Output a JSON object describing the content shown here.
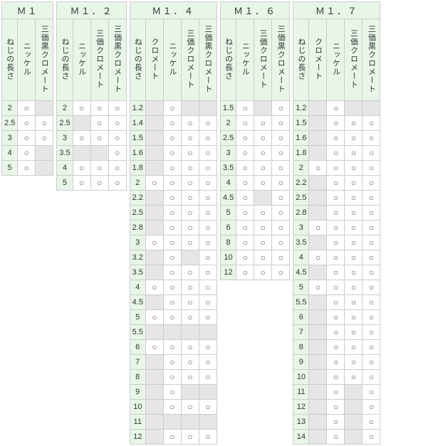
{
  "row_label": "ねじの長さ",
  "columns": {
    "n": "ニッケル",
    "c": "クロメート",
    "s": "三価クロメート",
    "b": "三価黒クロメート"
  },
  "tables": [
    {
      "title": "Ｍ１",
      "cols": [
        "n",
        "b"
      ],
      "rows": [
        {
          "len": "2",
          "v": [
            1,
            null
          ]
        },
        {
          "len": "2.5",
          "v": [
            1,
            1
          ]
        },
        {
          "len": "3",
          "v": [
            1,
            1
          ]
        },
        {
          "len": "4",
          "v": [
            1,
            null
          ]
        },
        {
          "len": "5",
          "v": [
            1,
            null
          ]
        }
      ]
    },
    {
      "title": "Ｍ１．２",
      "cols": [
        "n",
        "s",
        "b"
      ],
      "rows": [
        {
          "len": "2",
          "v": [
            1,
            1,
            1
          ]
        },
        {
          "len": "2.5",
          "v": [
            null,
            1,
            1
          ]
        },
        {
          "len": "3",
          "v": [
            1,
            1,
            1
          ]
        },
        {
          "len": "3.5",
          "v": [
            null,
            null,
            1
          ]
        },
        {
          "len": "4",
          "v": [
            1,
            1,
            1
          ]
        },
        {
          "len": "5",
          "v": [
            1,
            1,
            1
          ]
        }
      ]
    },
    {
      "title": "Ｍ１．４",
      "cols": [
        "c",
        "n",
        "s",
        "b"
      ],
      "rows": [
        {
          "len": "1.2",
          "v": [
            null,
            1,
            null,
            null
          ]
        },
        {
          "len": "1.4",
          "v": [
            null,
            1,
            1,
            1
          ]
        },
        {
          "len": "1.5",
          "v": [
            null,
            1,
            1,
            1
          ]
        },
        {
          "len": "1.6",
          "v": [
            null,
            1,
            1,
            1
          ]
        },
        {
          "len": "1.8",
          "v": [
            null,
            1,
            1,
            1
          ]
        },
        {
          "len": "2",
          "v": [
            1,
            1,
            1,
            1
          ]
        },
        {
          "len": "2.2",
          "v": [
            null,
            1,
            1,
            1
          ]
        },
        {
          "len": "2.5",
          "v": [
            null,
            1,
            1,
            1
          ]
        },
        {
          "len": "2.8",
          "v": [
            null,
            1,
            1,
            1
          ]
        },
        {
          "len": "3",
          "v": [
            1,
            1,
            1,
            1
          ]
        },
        {
          "len": "3.2",
          "v": [
            null,
            1,
            null,
            1
          ]
        },
        {
          "len": "3.5",
          "v": [
            null,
            1,
            1,
            1
          ]
        },
        {
          "len": "4",
          "v": [
            1,
            1,
            1,
            1
          ]
        },
        {
          "len": "4.5",
          "v": [
            null,
            1,
            1,
            1
          ]
        },
        {
          "len": "5",
          "v": [
            1,
            1,
            1,
            1
          ]
        },
        {
          "len": "5.5",
          "v": [
            null,
            null,
            null,
            null
          ]
        },
        {
          "len": "6",
          "v": [
            1,
            1,
            1,
            1
          ]
        },
        {
          "len": "7",
          "v": [
            null,
            1,
            1,
            1
          ]
        },
        {
          "len": "8",
          "v": [
            null,
            1,
            1,
            1
          ]
        },
        {
          "len": "9",
          "v": [
            null,
            1,
            null,
            null
          ]
        },
        {
          "len": "10",
          "v": [
            null,
            1,
            1,
            1
          ]
        },
        {
          "len": "11",
          "v": [
            null,
            null,
            null,
            null
          ]
        },
        {
          "len": "12",
          "v": [
            null,
            1,
            1,
            1
          ]
        }
      ]
    },
    {
      "title": "Ｍ１．６",
      "cols": [
        "n",
        "s",
        "b"
      ],
      "rows": [
        {
          "len": "1.5",
          "v": [
            1,
            null,
            1
          ]
        },
        {
          "len": "2",
          "v": [
            1,
            1,
            1
          ]
        },
        {
          "len": "2.5",
          "v": [
            1,
            1,
            1
          ]
        },
        {
          "len": "3",
          "v": [
            1,
            1,
            1
          ]
        },
        {
          "len": "3.5",
          "v": [
            1,
            1,
            1
          ]
        },
        {
          "len": "4",
          "v": [
            1,
            1,
            1
          ]
        },
        {
          "len": "4.5",
          "v": [
            1,
            null,
            1
          ]
        },
        {
          "len": "5",
          "v": [
            1,
            1,
            1
          ]
        },
        {
          "len": "6",
          "v": [
            1,
            1,
            1
          ]
        },
        {
          "len": "8",
          "v": [
            1,
            1,
            1
          ]
        },
        {
          "len": "10",
          "v": [
            1,
            1,
            1
          ]
        },
        {
          "len": "12",
          "v": [
            1,
            1,
            1
          ]
        }
      ]
    },
    {
      "title": "Ｍ１．７",
      "cols": [
        "c",
        "n",
        "s",
        "b"
      ],
      "rows": [
        {
          "len": "1.2",
          "v": [
            null,
            1,
            null,
            null
          ]
        },
        {
          "len": "1.5",
          "v": [
            null,
            1,
            1,
            1
          ]
        },
        {
          "len": "1.6",
          "v": [
            null,
            1,
            1,
            1
          ]
        },
        {
          "len": "1.8",
          "v": [
            null,
            1,
            1,
            1
          ]
        },
        {
          "len": "2",
          "v": [
            1,
            1,
            1,
            1
          ]
        },
        {
          "len": "2.2",
          "v": [
            null,
            1,
            1,
            1
          ]
        },
        {
          "len": "2.5",
          "v": [
            null,
            1,
            1,
            1
          ]
        },
        {
          "len": "2.8",
          "v": [
            null,
            1,
            1,
            1
          ]
        },
        {
          "len": "3",
          "v": [
            1,
            1,
            1,
            1
          ]
        },
        {
          "len": "3.5",
          "v": [
            null,
            1,
            1,
            1
          ]
        },
        {
          "len": "4",
          "v": [
            1,
            1,
            1,
            1
          ]
        },
        {
          "len": "4.5",
          "v": [
            null,
            1,
            1,
            1
          ]
        },
        {
          "len": "5",
          "v": [
            1,
            1,
            1,
            1
          ]
        },
        {
          "len": "5.5",
          "v": [
            null,
            1,
            1,
            1
          ]
        },
        {
          "len": "6",
          "v": [
            null,
            1,
            1,
            1
          ]
        },
        {
          "len": "7",
          "v": [
            null,
            1,
            1,
            1
          ]
        },
        {
          "len": "8",
          "v": [
            null,
            1,
            1,
            1
          ]
        },
        {
          "len": "9",
          "v": [
            null,
            1,
            1,
            1
          ]
        },
        {
          "len": "10",
          "v": [
            null,
            1,
            1,
            1
          ]
        },
        {
          "len": "11",
          "v": [
            null,
            1,
            null,
            1
          ]
        },
        {
          "len": "12",
          "v": [
            null,
            1,
            null,
            1
          ]
        },
        {
          "len": "13",
          "v": [
            null,
            1,
            null,
            1
          ]
        },
        {
          "len": "14",
          "v": [
            null,
            1,
            null,
            1
          ]
        }
      ]
    }
  ]
}
